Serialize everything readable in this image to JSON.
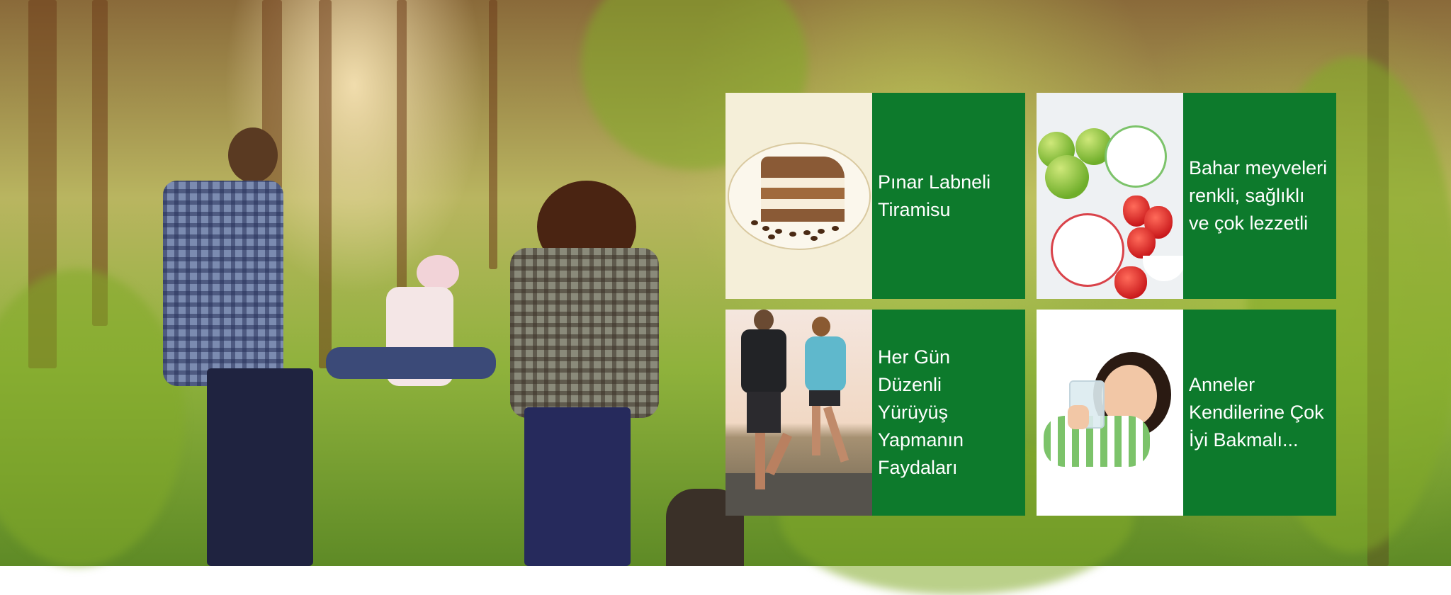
{
  "hero": {
    "alt": "Family walking in a sunlit forest"
  },
  "tiles": [
    {
      "title": "Pınar Labneli Tiramisu",
      "image": "tiramisu-cake"
    },
    {
      "title": "Bahar meyveleri renkli, sağlıklı ve çok lezzetli",
      "image": "apples-and-strawberries"
    },
    {
      "title": "Her Gün Düzenli Yürüyüş Yapmanın Faydaları",
      "image": "runners-on-road"
    },
    {
      "title": "Anneler Kendilerine Çok İyi Bakmalı...",
      "image": "child-with-yogurt"
    }
  ],
  "colors": {
    "tile_green": "#0d7a2c",
    "tile_text": "#ffffff"
  }
}
